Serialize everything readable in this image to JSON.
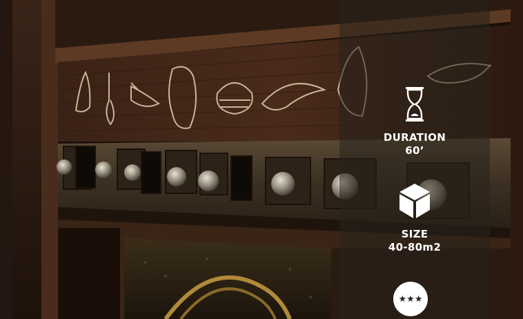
{
  "info_panel": {
    "duration": {
      "icon": "hourglass-icon",
      "label": "DURATION",
      "value": "60’"
    },
    "size": {
      "icon": "cube-icon",
      "label": "SIZE",
      "value": "40-80m2"
    },
    "difficulty": {
      "icon": "three-star-badge-icon",
      "stars": "★★★"
    }
  },
  "colors": {
    "overlay": "#2a221c",
    "text": "#ffffff"
  }
}
